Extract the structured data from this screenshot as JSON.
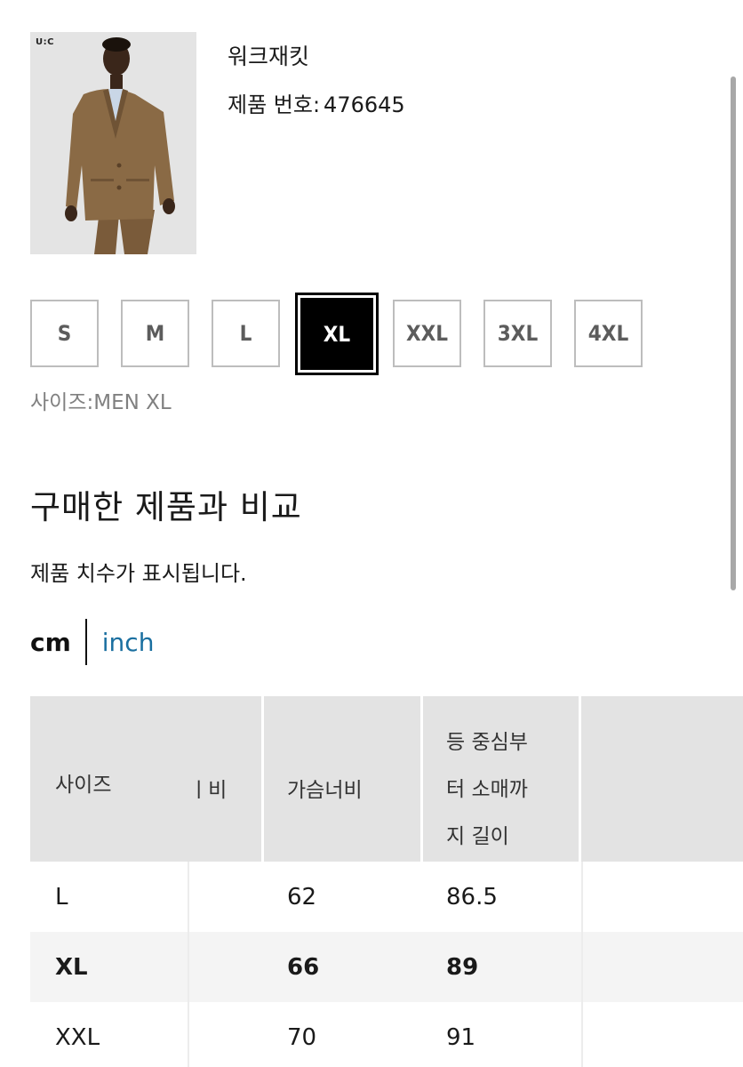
{
  "product": {
    "name": "워크재킷",
    "number_label": "제품 번호:",
    "number": "476645",
    "brand_mark": "U:C"
  },
  "sizes": [
    "S",
    "M",
    "L",
    "XL",
    "XXL",
    "3XL",
    "4XL"
  ],
  "selected_size": "XL",
  "size_caption": "사이즈:MEN XL",
  "compare": {
    "title": "구매한 제품과 비교",
    "description": "제품 치수가 표시됩니다."
  },
  "units": {
    "cm": "cm",
    "inch": "inch",
    "active": "cm"
  },
  "table": {
    "headers": [
      "사이즈",
      "ㅣ비",
      "가슴너비",
      "등 중심부\n터 소매까\n지 길이",
      ""
    ],
    "rows": [
      {
        "size": "L",
        "col2": "",
        "chest": "62",
        "sleeve": "86.5",
        "bold": false
      },
      {
        "size": "XL",
        "col2": "",
        "chest": "66",
        "sleeve": "89",
        "bold": true
      },
      {
        "size": "XXL",
        "col2": "",
        "chest": "70",
        "sleeve": "91",
        "bold": false
      }
    ]
  },
  "colors": {
    "accent_link": "#1a6fa0",
    "header_bg": "#e3e3e3",
    "selected_bg": "#000000",
    "jacket": "#8a6a45"
  }
}
